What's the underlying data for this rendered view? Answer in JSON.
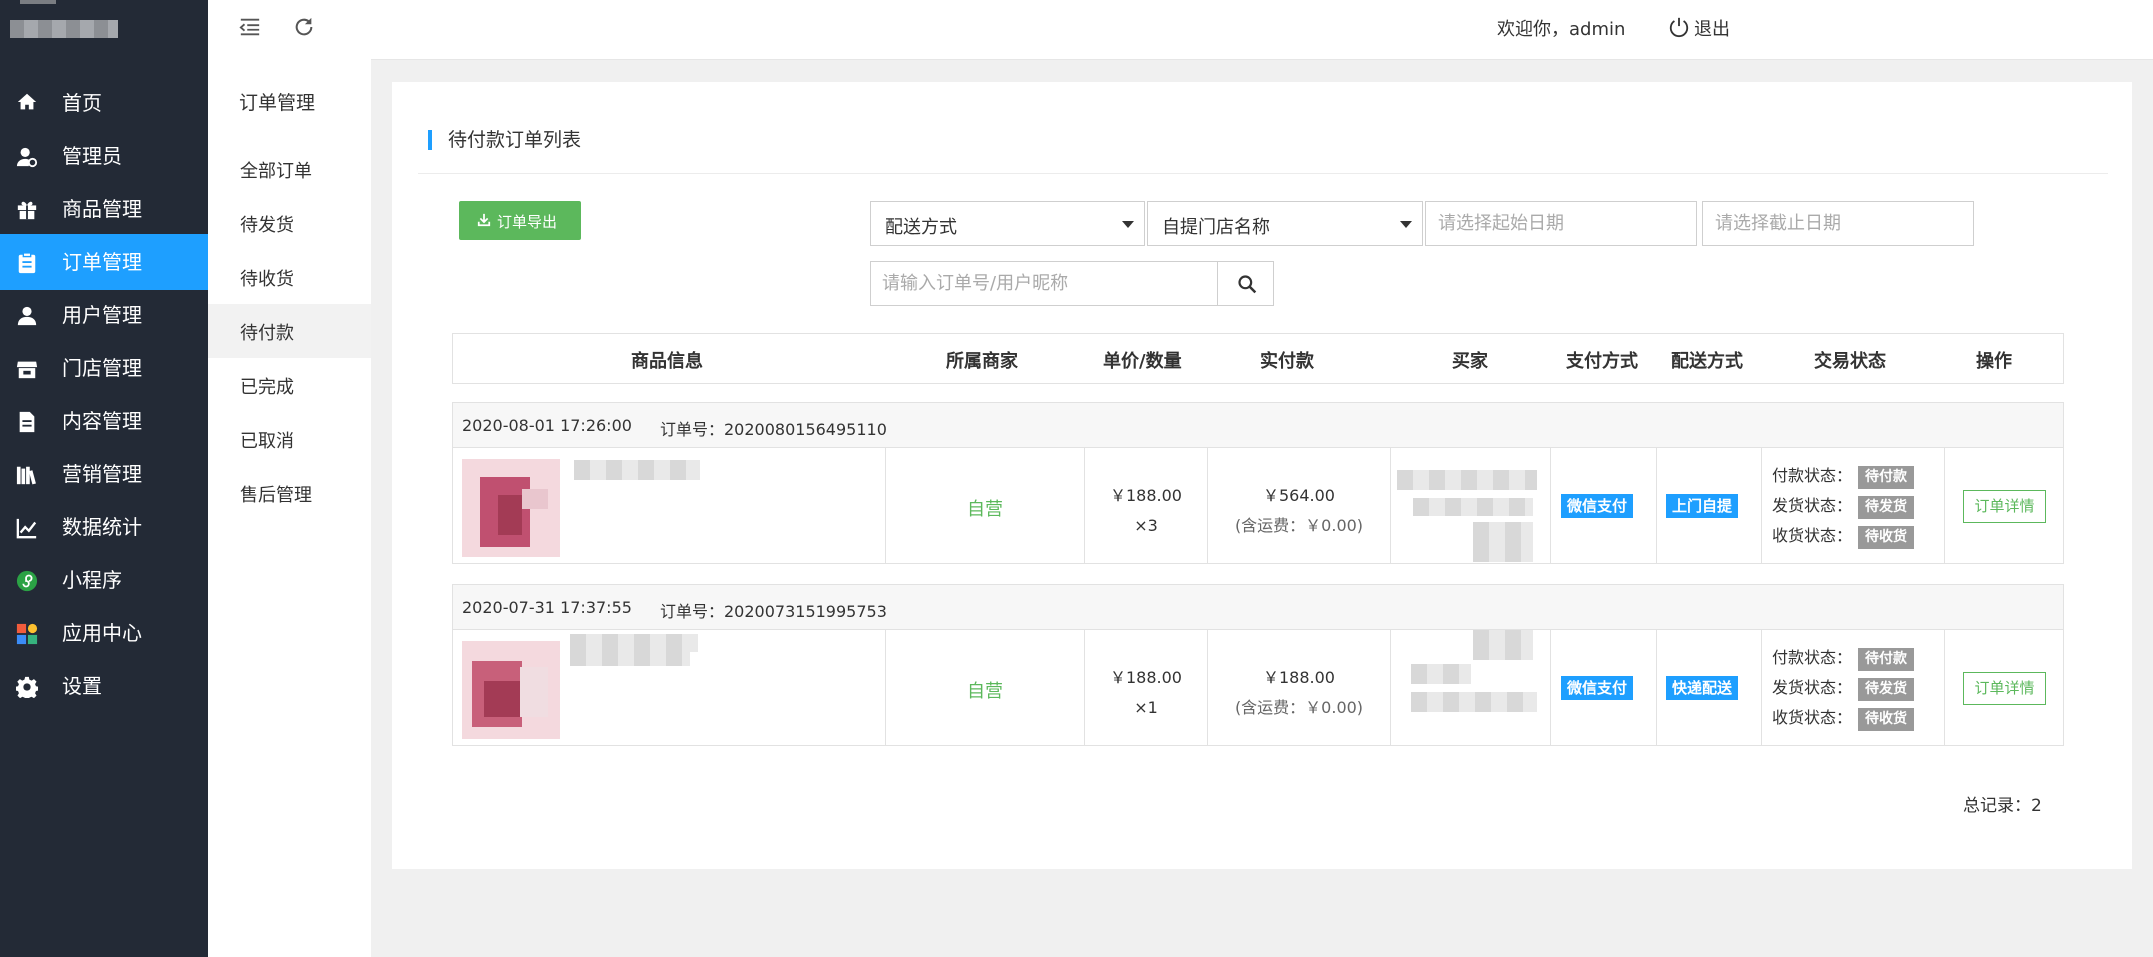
{
  "sidebar": {
    "items": [
      {
        "label": "首页",
        "icon": "home-icon"
      },
      {
        "label": "管理员",
        "icon": "admin-icon"
      },
      {
        "label": "商品管理",
        "icon": "gift-icon"
      },
      {
        "label": "订单管理",
        "icon": "clipboard-icon",
        "active": true
      },
      {
        "label": "用户管理",
        "icon": "user-icon"
      },
      {
        "label": "门店管理",
        "icon": "store-icon"
      },
      {
        "label": "内容管理",
        "icon": "document-icon"
      },
      {
        "label": "营销管理",
        "icon": "books-icon"
      },
      {
        "label": "数据统计",
        "icon": "chart-icon"
      },
      {
        "label": "小程序",
        "icon": "miniprogram-icon"
      },
      {
        "label": "应用中心",
        "icon": "apps-icon"
      },
      {
        "label": "设置",
        "icon": "gear-icon"
      }
    ]
  },
  "submenu": {
    "title": "订单管理",
    "items": [
      "全部订单",
      "待发货",
      "待收货",
      "待付款",
      "已完成",
      "已取消",
      "售后管理"
    ],
    "active_index": 3
  },
  "topbar": {
    "welcome": "欢迎你，admin",
    "logout": "退出"
  },
  "page": {
    "title": "待付款订单列表",
    "export_label": "订单导出",
    "delivery_select": "配送方式",
    "store_select": "自提门店名称",
    "start_date_placeholder": "请选择起始日期",
    "end_date_placeholder": "请选择截止日期",
    "search_placeholder": "请输入订单号/用户昵称",
    "total": "总记录：2"
  },
  "table": {
    "headers": [
      "商品信息",
      "所属商家",
      "单价/数量",
      "实付款",
      "买家",
      "支付方式",
      "配送方式",
      "交易状态",
      "操作"
    ],
    "orders": [
      {
        "time": "2020-08-01 17:26:00",
        "order_no_label": "订单号：2020080156495110",
        "merchant": "自营",
        "unit_price": "￥188.00",
        "quantity": "×3",
        "paid": "￥564.00",
        "shipping_fee": "(含运费：￥0.00)",
        "pay_method": "微信支付",
        "delivery": "上门自提",
        "pay_status_label": "付款状态：",
        "pay_status": "待付款",
        "ship_status_label": "发货状态：",
        "ship_status": "待发货",
        "recv_status_label": "收货状态：",
        "recv_status": "待收货",
        "action": "订单详情"
      },
      {
        "time": "2020-07-31 17:37:55",
        "order_no_label": "订单号：2020073151995753",
        "merchant": "自营",
        "unit_price": "￥188.00",
        "quantity": "×1",
        "paid": "￥188.00",
        "shipping_fee": "(含运费：￥0.00)",
        "pay_method": "微信支付",
        "delivery": "快递配送",
        "pay_status_label": "付款状态：",
        "pay_status": "待付款",
        "ship_status_label": "发货状态：",
        "ship_status": "待发货",
        "recv_status_label": "收货状态：",
        "recv_status": "待收货",
        "action": "订单详情"
      }
    ]
  },
  "colors": {
    "sidebar_bg": "#232a36",
    "accent": "#1e9fff",
    "success": "#5cb85c",
    "status_gray": "#999999"
  }
}
